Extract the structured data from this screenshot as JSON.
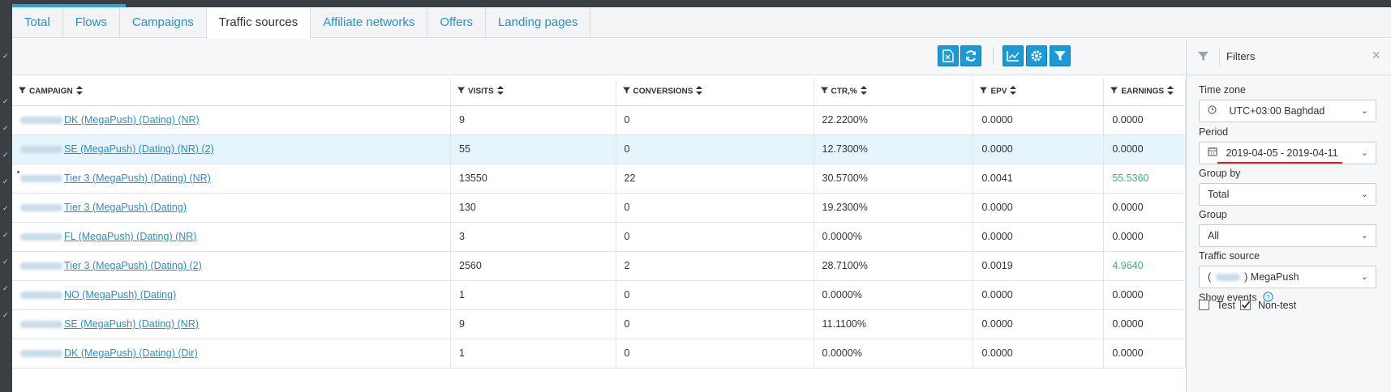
{
  "tabs": [
    "Total",
    "Flows",
    "Campaigns",
    "Traffic sources",
    "Affiliate networks",
    "Offers",
    "Landing pages"
  ],
  "active_tab_index": 3,
  "toolbar": {
    "buttons": [
      "excel-export-icon",
      "refresh-icon",
      "chart-icon",
      "settings-icon",
      "filter-icon"
    ]
  },
  "table": {
    "columns": [
      "CAMPAIGN",
      "VISITS",
      "CONVERSIONS",
      "CTR,%",
      "EPV",
      "EARNINGS"
    ],
    "rows": [
      {
        "campaign": "DK (MegaPush) (Dating) (NR)",
        "visits": "9",
        "conversions": "0",
        "ctr": "22.2200%",
        "epv": "0.0000",
        "earnings": "0.0000"
      },
      {
        "campaign": "SE (MegaPush) (Dating) (NR) (2)",
        "visits": "55",
        "conversions": "0",
        "ctr": "12.7300%",
        "epv": "0.0000",
        "earnings": "0.0000"
      },
      {
        "campaign": "Tier 3 (MegaPush) (Dating) (NR)",
        "visits": "13550",
        "conversions": "22",
        "ctr": "30.5700%",
        "epv": "0.0041",
        "earnings": "55.5360"
      },
      {
        "campaign": "Tier 3 (MegaPush) (Dating)",
        "visits": "130",
        "conversions": "0",
        "ctr": "19.2300%",
        "epv": "0.0000",
        "earnings": "0.0000"
      },
      {
        "campaign": "FL (MegaPush) (Dating) (NR)",
        "visits": "3",
        "conversions": "0",
        "ctr": "0.0000%",
        "epv": "0.0000",
        "earnings": "0.0000"
      },
      {
        "campaign": "Tier 3 (MegaPush) (Dating) (2)",
        "visits": "2560",
        "conversions": "2",
        "ctr": "28.7100%",
        "epv": "0.0019",
        "earnings": "4.9640"
      },
      {
        "campaign": "NO (MegaPush) (Dating)",
        "visits": "1",
        "conversions": "0",
        "ctr": "0.0000%",
        "epv": "0.0000",
        "earnings": "0.0000"
      },
      {
        "campaign": "SE (MegaPush) (Dating) (NR)",
        "visits": "9",
        "conversions": "0",
        "ctr": "11.1100%",
        "epv": "0.0000",
        "earnings": "0.0000"
      },
      {
        "campaign": "DK (MegaPush) (Dating) (Dir)",
        "visits": "1",
        "conversions": "0",
        "ctr": "0.0000%",
        "epv": "0.0000",
        "earnings": "0.0000"
      }
    ],
    "highlighted_row_index": 1,
    "positive_earnings_color": "#3cb371"
  },
  "filters": {
    "title": "Filters",
    "timezone_label": "Time zone",
    "timezone_value": "UTC+03:00 Baghdad",
    "period_label": "Period",
    "period_value": "2019-04-05 - 2019-04-11",
    "group_by_label": "Group by",
    "group_by_value": "Total",
    "group_label": "Group",
    "group_value": "All",
    "traffic_source_label": "Traffic source",
    "traffic_source_prefix": "(",
    "traffic_source_value": ") MegaPush",
    "show_events_label": "Show events",
    "test_label": "Test",
    "test_checked": false,
    "nontest_label": "Non-test",
    "nontest_checked": true
  },
  "colors": {
    "accent": "#1a9ad6",
    "link": "#2a8fc7",
    "highlight_row": "#e6f5fb",
    "annotation_red": "#e02020"
  }
}
